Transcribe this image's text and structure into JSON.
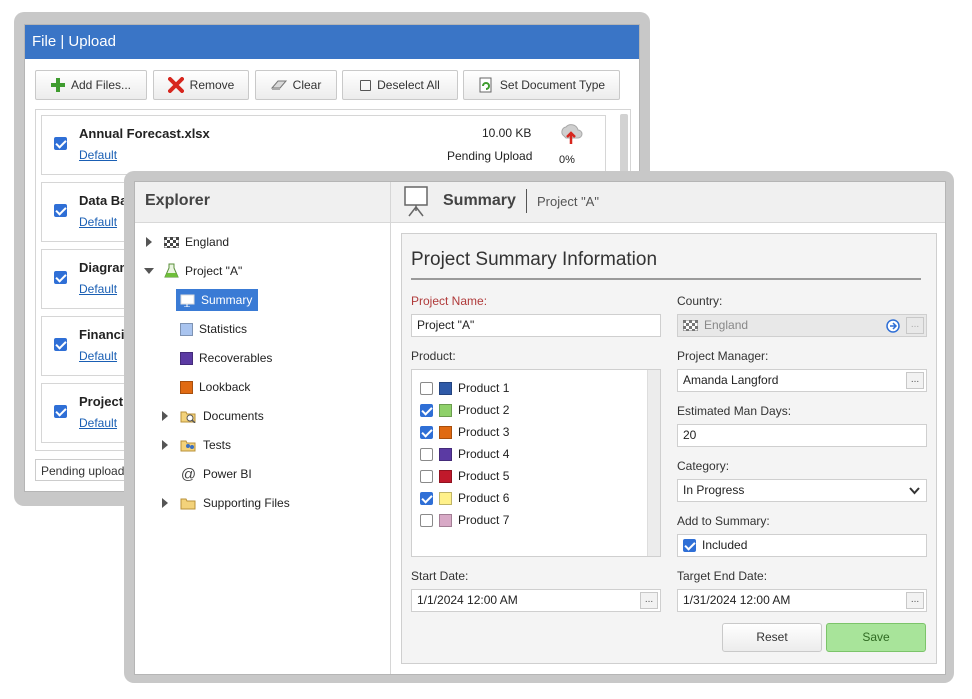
{
  "upload": {
    "title": "File | Upload",
    "toolbar": {
      "add_files": "Add Files...",
      "remove": "Remove",
      "clear": "Clear",
      "deselect_all": "Deselect All",
      "set_document_type": "Set Document Type"
    },
    "files": [
      {
        "name": "Annual Forecast.xlsx",
        "type": "Default",
        "size": "10.00 KB",
        "status": "Pending Upload",
        "progress": "0%"
      },
      {
        "name": "Data Bac",
        "type": "Default"
      },
      {
        "name": "Diagram.s",
        "type": "Default"
      },
      {
        "name": "Financial",
        "type": "Default"
      },
      {
        "name": "Project O",
        "type": "Default"
      }
    ],
    "status_bar": "Pending upload"
  },
  "explorer": {
    "title": "Explorer",
    "items": [
      {
        "label": "England",
        "icon": "flag-checkered-icon"
      },
      {
        "label": "Project \"A\"",
        "icon": "flask-icon"
      },
      {
        "label": "Summary",
        "icon": "presentation-icon",
        "selected": true
      },
      {
        "label": "Statistics",
        "color": "#a9c4ef"
      },
      {
        "label": "Recoverables",
        "color": "#5b3aa3"
      },
      {
        "label": "Lookback",
        "color": "#e06a12"
      },
      {
        "label": "Documents",
        "icon": "folder-search-icon"
      },
      {
        "label": "Tests",
        "icon": "folder-people-icon"
      },
      {
        "label": "Power BI",
        "icon": "at-sign-icon"
      },
      {
        "label": "Supporting Files",
        "icon": "folder-icon"
      }
    ]
  },
  "summary": {
    "title": "Summary",
    "breadcrumb": "Project \"A\"",
    "heading": "Project Summary Information",
    "project_name_label": "Project Name:",
    "project_name_value": "Project \"A\"",
    "country_label": "Country:",
    "country_value": "England",
    "product_label": "Product:",
    "products": [
      {
        "label": "Product 1",
        "checked": false,
        "color": "#2f5aa8"
      },
      {
        "label": "Product 2",
        "checked": true,
        "color": "#8fd16a"
      },
      {
        "label": "Product 3",
        "checked": true,
        "color": "#e06a12"
      },
      {
        "label": "Product 4",
        "checked": false,
        "color": "#5b3aa3"
      },
      {
        "label": "Product 5",
        "checked": false,
        "color": "#c0192b"
      },
      {
        "label": "Product 6",
        "checked": true,
        "color": "#fff18a"
      },
      {
        "label": "Product 7",
        "checked": false,
        "color": "#d8a9c6"
      }
    ],
    "manager_label": "Project Manager:",
    "manager_value": "Amanda Langford",
    "man_days_label": "Estimated Man Days:",
    "man_days_value": "20",
    "category_label": "Category:",
    "category_value": "In Progress",
    "add_to_summary_label": "Add to Summary:",
    "add_to_summary_value": "Included",
    "start_date_label": "Start Date:",
    "start_date_value": "1/1/2024 12:00 AM",
    "target_end_label": "Target End Date:",
    "target_end_value": "1/31/2024 12:00 AM",
    "reset_label": "Reset",
    "save_label": "Save",
    "ellipsis": "..."
  },
  "colors": {
    "accent": "#3a75c6",
    "selected": "#3a7bd5",
    "save_bg": "#a8e49a"
  }
}
